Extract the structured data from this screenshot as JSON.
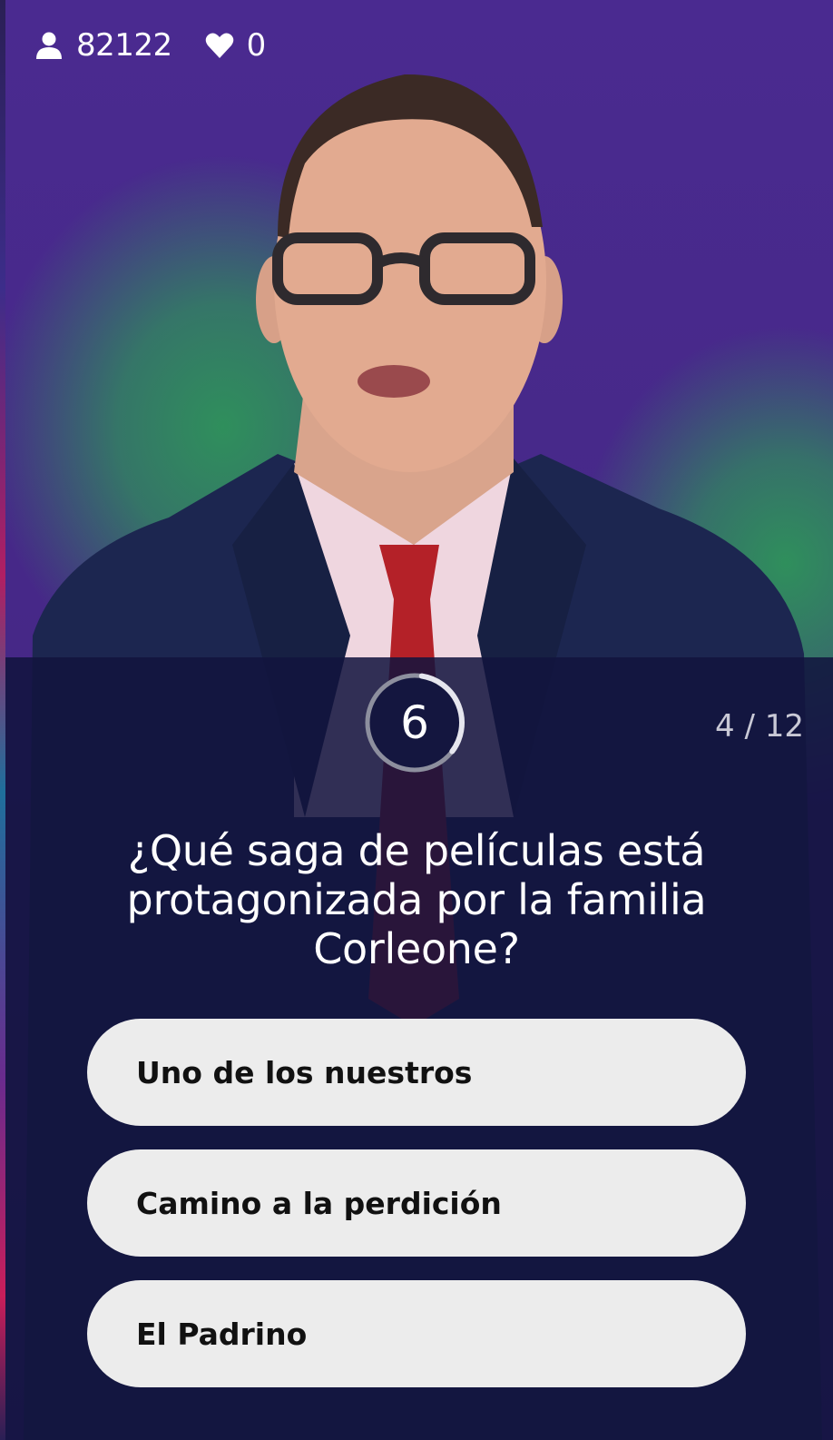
{
  "header": {
    "viewers_icon": "person-icon",
    "viewers_count": "82122",
    "lives_icon": "heart-icon",
    "lives_count": "0"
  },
  "timer": {
    "seconds": "6",
    "remaining_fraction": 0.33
  },
  "progress": {
    "label": "4 / 12"
  },
  "question": {
    "text": "¿Qué saga de películas está protagonizada por la familia Corleone?"
  },
  "answers": [
    {
      "label": "Uno de los nuestros"
    },
    {
      "label": "Camino a la perdición"
    },
    {
      "label": "El Padrino"
    }
  ],
  "colors": {
    "background_purple": "#452886",
    "glow_green": "#2f8f5c",
    "panel_navy": "#12143e",
    "answer_bg": "#ececec"
  }
}
